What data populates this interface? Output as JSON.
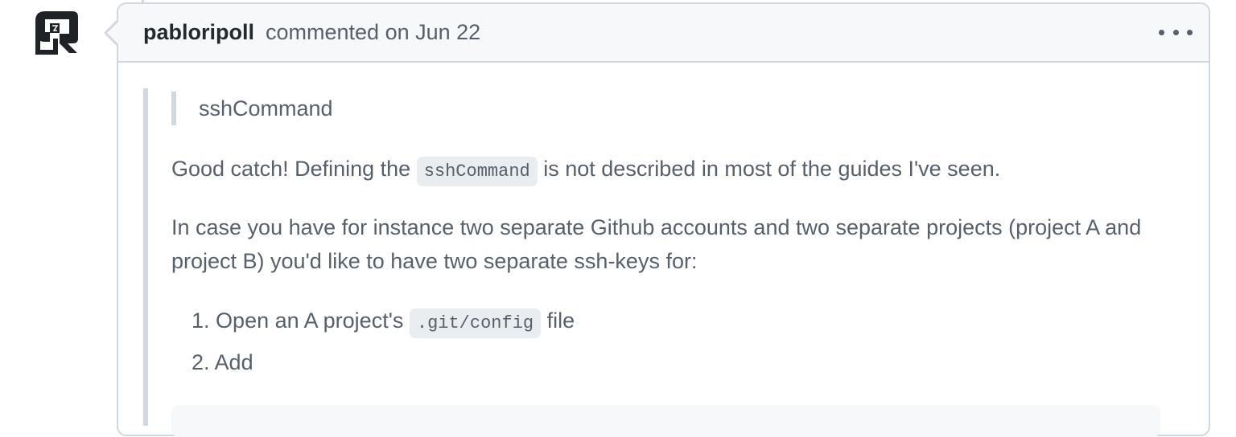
{
  "comment": {
    "author": "pabloripoll",
    "meta": "commented on Jun 22",
    "quote": "sshCommand",
    "para1": {
      "before": "Good catch! Defining the",
      "code": "sshCommand",
      "after": "is not described in most of the guides I've seen."
    },
    "para2": "In case you have for instance two separate Github accounts and two separate projects (project A and project B) you'd like to have two separate ssh-keys for:",
    "list": [
      {
        "num": "1.",
        "before": "Open an A project's",
        "code": ".git/config",
        "after": "file"
      },
      {
        "num": "2.",
        "text": "Add"
      }
    ]
  },
  "icons": {
    "avatar": "avatar-icon",
    "menu": "kebab-menu-icon"
  },
  "colors": {
    "border": "#d0d7de",
    "header_bg": "#f6f8fa",
    "muted_text": "#57606a",
    "code_bg": "#eaedf0"
  }
}
